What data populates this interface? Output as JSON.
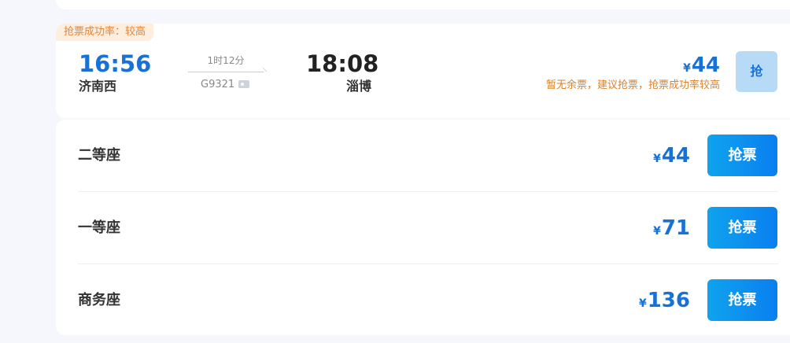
{
  "train": {
    "success_rate_tag": "抢票成功率：较高",
    "departure_time": "16:56",
    "departure_station": "济南西",
    "duration": "1时12分",
    "train_number": "G9321",
    "arrival_time": "18:08",
    "arrival_station": "淄博",
    "currency_symbol": "¥",
    "lowest_price": "44",
    "availability_hint": "暂无余票，建议抢票，抢票成功率较高",
    "grab_label": "抢"
  },
  "seats": [
    {
      "name": "二等座",
      "currency_symbol": "¥",
      "price": "44",
      "button_label": "抢票"
    },
    {
      "name": "一等座",
      "currency_symbol": "¥",
      "price": "71",
      "button_label": "抢票"
    },
    {
      "name": "商务座",
      "currency_symbol": "¥",
      "price": "136",
      "button_label": "抢票"
    }
  ],
  "colors": {
    "accent_blue": "#1872d6",
    "hint_orange": "#d9822b",
    "tag_background": "#fdeedd",
    "button_gradient_start": "#0fa3ee",
    "button_gradient_end": "#0a7ff0",
    "page_background": "#f5f7fc"
  },
  "icons": {
    "id_card": "id-card-icon",
    "route_arrow": "arrow-right-icon"
  }
}
